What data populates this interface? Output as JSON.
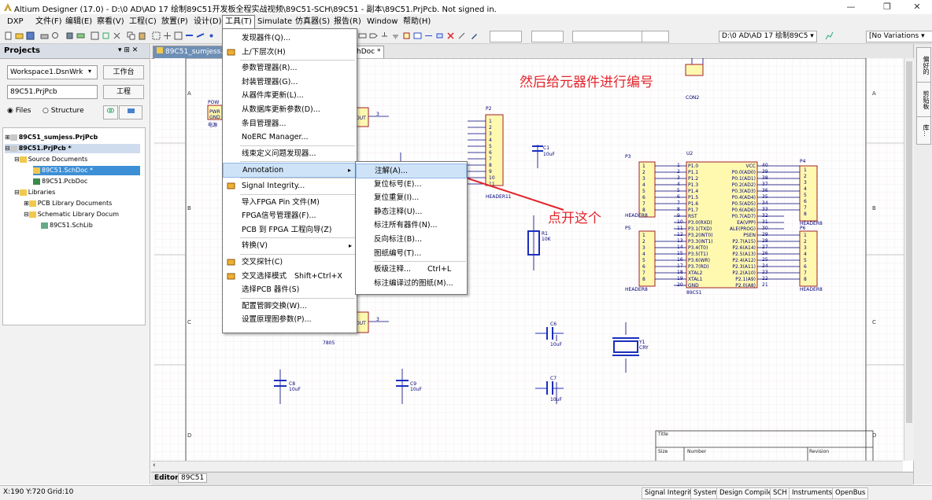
{
  "window": {
    "title": "Altium Designer (17.0) - D:\\0 AD\\AD 17 绘制89C51开发板全程实战视频\\89C51-SCH\\89C51 - 副本\\89C51.PrjPcb. Not signed in.",
    "min_glyph": "—",
    "max_glyph": "❐",
    "close_glyph": "✕"
  },
  "menubar": {
    "items": [
      "DXP",
      "文件(F)",
      "编辑(E)",
      "察看(V)",
      "工程(C)",
      "放置(P)",
      "设计(D)",
      "工具(T)",
      "Simulate",
      "仿真器(S)",
      "报告(R)",
      "Window",
      "帮助(H)"
    ],
    "open_item": "工具(T)"
  },
  "toolbar": {
    "path_combo": "D:\\0 AD\\AD 17 绘制89C5 ▾",
    "variations_combo": "[No Variations ▾"
  },
  "projects_panel": {
    "title": "Projects",
    "pin_glyph": "▾ ⊞ ✕",
    "workspace_field": "Workspace1.DsnWrk",
    "workspace_button": "工作台",
    "project_field": "89C51.PrjPcb",
    "project_button": "工程",
    "radio_files": "Files",
    "radio_structure": "Structure",
    "tree": [
      {
        "label": "89C51_sumjess.PrjPcb",
        "bold": true,
        "level": 0,
        "state": "normal"
      },
      {
        "label": "89C51.PrjPcb *",
        "bold": true,
        "level": 0,
        "state": "selected-project"
      },
      {
        "label": "Source Documents",
        "bold": false,
        "level": 1,
        "state": "normal"
      },
      {
        "label": "89C51.SchDoc *",
        "bold": false,
        "level": 2,
        "state": "selected"
      },
      {
        "label": "89C51.PcbDoc",
        "bold": false,
        "level": 2,
        "state": "normal"
      },
      {
        "label": "Libraries",
        "bold": false,
        "level": 1,
        "state": "normal"
      },
      {
        "label": "PCB Library Documents",
        "bold": false,
        "level": 2,
        "state": "normal"
      },
      {
        "label": "Schematic Library Docum",
        "bold": false,
        "level": 2,
        "state": "normal"
      },
      {
        "label": "89C51.SchLib",
        "bold": false,
        "level": 3,
        "state": "normal"
      }
    ]
  },
  "doc_tabs": [
    {
      "label": "89C51_sumjess.Sch",
      "active": false
    },
    {
      "label": "hDoc *",
      "active": true
    }
  ],
  "tools_menu": {
    "items": [
      {
        "label": "发现器件(Q)...",
        "shortcut": "",
        "submenu": false,
        "icon": "none"
      },
      {
        "label": "上/下层次(H)",
        "shortcut": "",
        "submenu": false,
        "icon": "hierarchy-icon"
      },
      {
        "sep": true
      },
      {
        "label": "参数管理器(R)...",
        "shortcut": "",
        "submenu": false,
        "icon": "none"
      },
      {
        "label": "封装管理器(G)...",
        "shortcut": "",
        "submenu": false,
        "icon": "none"
      },
      {
        "label": "从器件库更新(L)...",
        "shortcut": "",
        "submenu": false,
        "icon": "none"
      },
      {
        "label": "从数据库更新参数(D)...",
        "shortcut": "",
        "submenu": false,
        "icon": "none"
      },
      {
        "label": "条目管理器...",
        "shortcut": "",
        "submenu": false,
        "icon": "none"
      },
      {
        "label": "NoERC Manager...",
        "shortcut": "",
        "submenu": false,
        "icon": "none"
      },
      {
        "sep": true
      },
      {
        "label": "线束定义问题发现器...",
        "shortcut": "",
        "submenu": false,
        "icon": "none"
      },
      {
        "sep": true
      },
      {
        "label": "Annotation",
        "shortcut": "",
        "submenu": true,
        "icon": "none",
        "highlight": true
      },
      {
        "sep": true
      },
      {
        "label": "Signal Integrity...",
        "shortcut": "",
        "submenu": false,
        "icon": "signal-integrity-icon"
      },
      {
        "sep": true
      },
      {
        "label": "导入FPGA Pin 文件(M)",
        "shortcut": "",
        "submenu": false,
        "icon": "none"
      },
      {
        "label": "FPGA信号管理器(F)...",
        "shortcut": "",
        "submenu": false,
        "icon": "none"
      },
      {
        "label": "PCB 到 FPGA 工程向导(Z)",
        "shortcut": "",
        "submenu": false,
        "icon": "none"
      },
      {
        "sep": true
      },
      {
        "label": "转换(V)",
        "shortcut": "",
        "submenu": true,
        "icon": "none"
      },
      {
        "sep": true
      },
      {
        "label": "交叉探针(C)",
        "shortcut": "",
        "submenu": false,
        "icon": "cross-probe-icon"
      },
      {
        "label": "交叉选择模式",
        "shortcut": "Shift+Ctrl+X",
        "submenu": false,
        "icon": "cross-select-icon"
      },
      {
        "label": "选择PCB 器件(S)",
        "shortcut": "",
        "submenu": false,
        "icon": "none"
      },
      {
        "sep": true
      },
      {
        "label": "配置管脚交换(W)...",
        "shortcut": "",
        "submenu": false,
        "icon": "none"
      },
      {
        "label": "设置原理图参数(P)...",
        "shortcut": "",
        "submenu": false,
        "icon": "none"
      }
    ],
    "submenu_arrow": "▸"
  },
  "annotation_submenu": {
    "items": [
      {
        "label": "注解(A)...",
        "shortcut": "",
        "highlight": true
      },
      {
        "label": "复位标号(E)...",
        "shortcut": ""
      },
      {
        "label": "复位重复(I)...",
        "shortcut": ""
      },
      {
        "label": "静态注释(U)...",
        "shortcut": ""
      },
      {
        "label": "标注所有器件(N)...",
        "shortcut": ""
      },
      {
        "label": "反向标注(B)...",
        "shortcut": ""
      },
      {
        "label": "图纸编号(T)...",
        "shortcut": ""
      },
      {
        "sep": true
      },
      {
        "label": "板级注释...",
        "shortcut": "Ctrl+L"
      },
      {
        "label": "标注编译过的图纸(M)...",
        "shortcut": ""
      }
    ]
  },
  "annotations": {
    "top_text": "然后给元器件进行编号",
    "arrow_text": "点开这个",
    "color": "#e3242b"
  },
  "schematic": {
    "zone_letters": [
      "A",
      "B",
      "C",
      "D"
    ],
    "labels": {
      "p2": "P2",
      "header11": "HEADER11",
      "c1": "C1",
      "c1v": "10uF",
      "con2": "CON2",
      "p3": "P3",
      "header8a": "HEADER8",
      "p5": "P5",
      "header8b": "HEADER8",
      "u2": "U2",
      "p4": "P4",
      "header8c": "HEADER8",
      "p6": "P6",
      "header8d": "HEADER8",
      "mcu": "89C51",
      "r1": "R1",
      "r1v": "10K",
      "c6": "C6",
      "c6v": "10uF",
      "y1": "Y1",
      "y1v": "CRY",
      "c7": "C7",
      "c7v": "10uF",
      "c8": "C8",
      "c8v": "10uF",
      "c9": "C9",
      "c9v": "10uF",
      "out1": "OUT",
      "out2": "OUT",
      "reg": "7805",
      "pwr": "POW",
      "pwr2": "PWR",
      "gnd": "GND",
      "elec": "电源",
      "three1": "3",
      "three2": "3",
      "title_lbl": "Title",
      "size_lbl": "Size",
      "number_lbl": "Number",
      "revision_lbl": "Revision"
    },
    "mcu_left_pins": [
      "P1.0",
      "P1.1",
      "P1.2",
      "P1.3",
      "P1.4",
      "P1.5",
      "P1.6",
      "P1.7",
      "RST",
      "P3.0(RXD)",
      "P3.1(TXD)",
      "P3.2(INT0)",
      "P3.3(INT1)",
      "P3.4(T0)",
      "P3.5(T1)",
      "P3.6(WR)",
      "P3.7(RD)",
      "XTAL2",
      "XTAL1",
      "GND"
    ],
    "mcu_left_nums": [
      "1",
      "2",
      "3",
      "4",
      "5",
      "6",
      "7",
      "8",
      "9",
      "10",
      "11",
      "12",
      "13",
      "14",
      "15",
      "16",
      "17",
      "18",
      "19",
      "20"
    ],
    "mcu_right_pins": [
      "VCC",
      "P0.0(AD0)",
      "P0.1(AD1)",
      "P0.2(AD2)",
      "P0.3(AD3)",
      "P0.4(AD4)",
      "P0.5(AD5)",
      "P0.6(AD6)",
      "P0.7(AD7)",
      "EA(VPP)",
      "ALE(PROG)",
      "PSEN",
      "P2.7(A15)",
      "P2.6(A14)",
      "P2.5(A13)",
      "P2.4(A12)",
      "P2.3(A11)",
      "P2.2(A10)",
      "P2.1(A9)",
      "P2.0(A8)"
    ],
    "mcu_right_nums": [
      "40",
      "39",
      "38",
      "37",
      "36",
      "35",
      "34",
      "33",
      "32",
      "31",
      "30",
      "29",
      "28",
      "27",
      "26",
      "25",
      "24",
      "23",
      "22",
      "21"
    ],
    "header_pins8": [
      "1",
      "2",
      "3",
      "4",
      "5",
      "6",
      "7",
      "8"
    ],
    "header_pins11": [
      "1",
      "2",
      "3",
      "4",
      "5",
      "6",
      "7",
      "8",
      "9",
      "10",
      "11"
    ]
  },
  "right_panel_tabs": [
    "偏好的",
    "剪贴板",
    "库..."
  ],
  "editor_bar": {
    "editor_label": "Editor",
    "doc_label": "89C51"
  },
  "status_bar": {
    "coords": "X:190 Y:720",
    "grid": "Grid:10",
    "tabs": [
      "Signal Integrity",
      "System",
      "Design Compiler",
      "SCH",
      "Instruments",
      "OpenBus"
    ]
  },
  "colors": {
    "menu_highlight": "#cfe3f8",
    "schematic_blue": "#1a2fbf",
    "component_fill": "#fff9b0",
    "component_border": "#a0202a",
    "annotation_red": "#e3242b",
    "selection_blue": "#3d8fd6"
  }
}
